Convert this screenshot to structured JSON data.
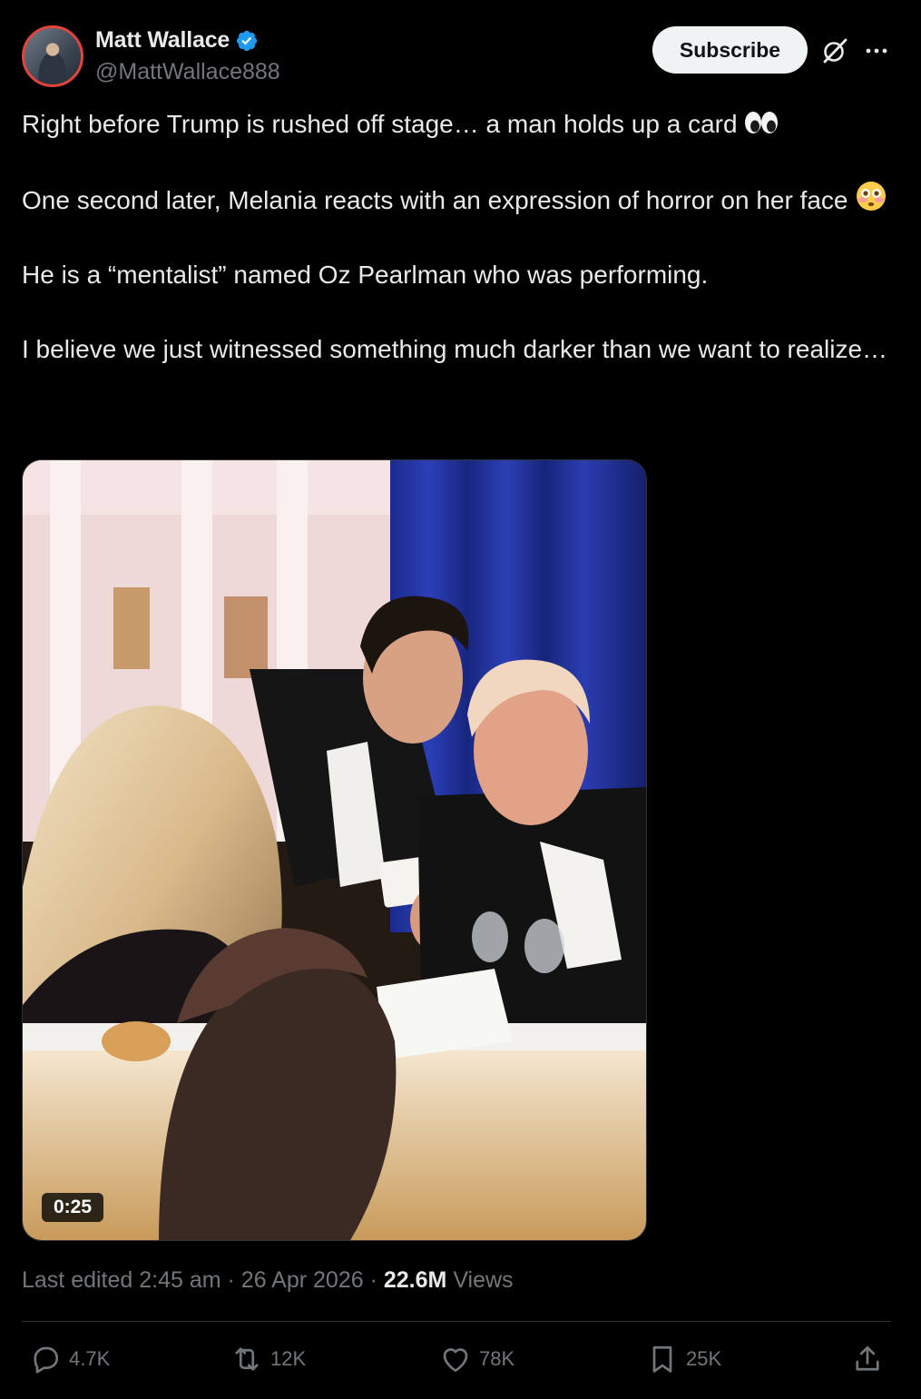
{
  "author": {
    "name": "Matt Wallace",
    "handle": "@MattWallace888",
    "verified_color": "#1d9bf0"
  },
  "header": {
    "subscribe_label": "Subscribe",
    "icons": [
      "grok-icon",
      "more-icon"
    ]
  },
  "tweet": {
    "paragraphs": {
      "p1": "Right before Trump is rushed off stage… a man holds up a card",
      "p2": "One second later, Melania reacts with an expression of horror on her face",
      "p3": "He is a “mentalist” named Oz Pearlman who was performing.",
      "p4": "I believe we just witnessed something much darker than we want to realize…"
    },
    "emojis": [
      "eyes-emoji",
      "flushed-face-emoji"
    ]
  },
  "media": {
    "duration": "0:25"
  },
  "meta": {
    "edited": "Last edited 2:45 am · 26 Apr 2026 ·",
    "views_count": "22.6M",
    "views_label": "Views"
  },
  "actions": {
    "replies": "4.7K",
    "reposts": "12K",
    "likes": "78K",
    "bookmarks": "25K"
  },
  "colors": {
    "background": "#000000",
    "text": "#e7e9ea",
    "secondary": "#71767b",
    "accent": "#1d9bf0",
    "divider": "#2f3336"
  }
}
